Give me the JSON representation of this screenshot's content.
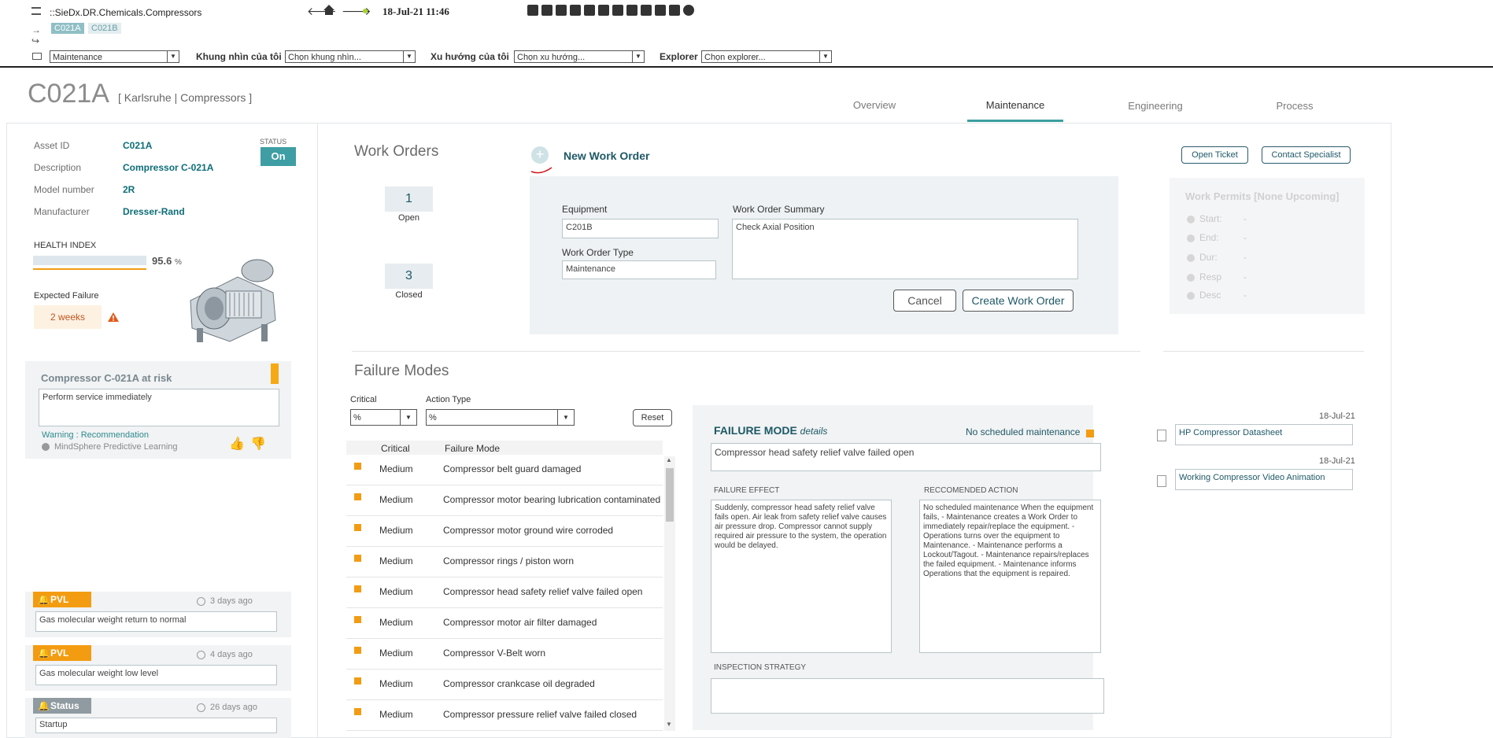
{
  "toolbar": {
    "path": "::SieDx.DR.Chemicals.Compressors",
    "chip_selected": "C021A",
    "chip_other": "C021B",
    "datetime": "18-Jul-21 11:46",
    "view_select": "Maintenance",
    "khung_label": "Khung nhìn của tôi",
    "khung_value": "Chọn khung nhìn...",
    "xuhuong_label": "Xu hướng của tôi",
    "xuhuong_value": "Chọn xu hướng...",
    "explorer_label": "Explorer",
    "explorer_value": "Chọn explorer..."
  },
  "header": {
    "asset_title": "C021A",
    "location": "[ Karlsruhe | Compressors ]",
    "tabs": [
      "Overview",
      "Maintenance",
      "Engineering",
      "Process"
    ],
    "active_tab": "Maintenance"
  },
  "asset": {
    "fields": [
      {
        "label": "Asset ID",
        "value": "C021A"
      },
      {
        "label": "Description",
        "value": "Compressor C-021A"
      },
      {
        "label": "Model number",
        "value": "2R"
      },
      {
        "label": "Manufacturer",
        "value": "Dresser-Rand"
      }
    ],
    "status_label": "STATUS",
    "status_value": "On",
    "health_label": "HEALTH INDEX",
    "health_value": "95.6",
    "health_unit": "%",
    "health_fraction": 0.956,
    "expected_failure_label": "Expected Failure",
    "expected_failure_value": "2 weeks"
  },
  "risk_card": {
    "title": "Compressor C-021A at risk",
    "message": "Perform service immediately",
    "type": "Warning : Recommendation",
    "source": "MindSphere Predictive Learning"
  },
  "alerts": [
    {
      "tag": "PVL",
      "age": "3 days ago",
      "message": "Gas molecular weight return to normal"
    },
    {
      "tag": "PVL",
      "age": "4 days ago",
      "message": "Gas molecular weight low level"
    },
    {
      "tag": "Status",
      "age": "26 days ago",
      "message": "Startup"
    }
  ],
  "work_orders": {
    "title": "Work Orders",
    "open_count": "1",
    "open_label": "Open",
    "closed_count": "3",
    "closed_label": "Closed",
    "new_label": "New Work Order",
    "open_ticket": "Open Ticket",
    "contact_specialist": "Contact Specialist",
    "equipment_label": "Equipment",
    "equipment_value": "C201B",
    "type_label": "Work Order Type",
    "type_value": "Maintenance",
    "summary_label": "Work Order Summary",
    "summary_value": "Check Axial Position",
    "cancel": "Cancel",
    "create": "Create Work Order"
  },
  "permits": {
    "title": "Work Permits [None Upcoming]",
    "rows": [
      {
        "label": "Start:",
        "value": "-"
      },
      {
        "label": "End:",
        "value": "-"
      },
      {
        "label": "Dur:",
        "value": "-"
      },
      {
        "label": "Resp",
        "value": "-"
      },
      {
        "label": "Desc",
        "value": "-"
      }
    ]
  },
  "failure_modes": {
    "title": "Failure Modes",
    "critical_label": "Critical",
    "critical_value": "%",
    "action_label": "Action Type",
    "action_value": "%",
    "reset": "Reset",
    "col_critical": "Critical",
    "col_mode": "Failure Mode",
    "rows": [
      {
        "critical": "Medium",
        "mode": "Compressor belt guard damaged"
      },
      {
        "critical": "Medium",
        "mode": "Compressor motor bearing lubrication contaminated"
      },
      {
        "critical": "Medium",
        "mode": "Compressor motor ground wire corroded"
      },
      {
        "critical": "Medium",
        "mode": "Compressor rings / piston worn"
      },
      {
        "critical": "Medium",
        "mode": "Compressor head safety relief valve failed open"
      },
      {
        "critical": "Medium",
        "mode": "Compressor motor air filter damaged"
      },
      {
        "critical": "Medium",
        "mode": "Compressor V-Belt worn"
      },
      {
        "critical": "Medium",
        "mode": "Compressor crankcase oil degraded"
      },
      {
        "critical": "Medium",
        "mode": "Compressor pressure relief valve failed closed"
      }
    ]
  },
  "fm_details": {
    "heading": "FAILURE MODE",
    "heading_sub": "details",
    "maintenance_note": "No scheduled maintenance",
    "selected_mode": "Compressor head safety relief valve failed open",
    "effect_label": "FAILURE EFFECT",
    "effect_text": "Suddenly, compressor head safety relief valve fails open. Air leak from safety relief valve causes air pressure drop. Compressor cannot supply required air pressure to the system, the operation would be delayed.",
    "action_label": "RECCOMENDED ACTION",
    "action_text": "No scheduled maintenance When the equipment fails, - Maintenance creates a Work Order to immediately repair/replace the equipment.  - Operations turns over the equipment to Maintenance.  - Maintenance performs a Lockout/Tagout.  - Maintenance repairs/replaces the failed equipment. - Maintenance informs Operations that the equipment is repaired.",
    "inspection_label": "INSPECTION STRATEGY"
  },
  "documents": [
    {
      "date": "18-Jul-21",
      "name": "HP Compressor Datasheet"
    },
    {
      "date": "18-Jul-21",
      "name": "Working Compressor Video Animation"
    }
  ]
}
